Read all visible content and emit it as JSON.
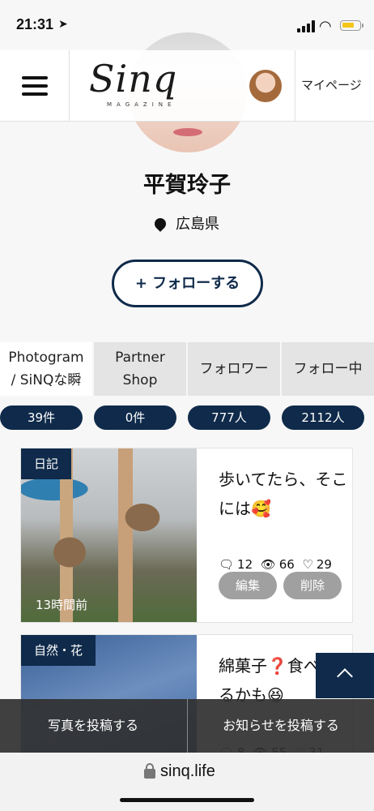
{
  "status_bar": {
    "time": "21:31",
    "location_arrow": "location-arrow-icon"
  },
  "header": {
    "menu_icon": "hamburger-icon",
    "logo_text": "Sinq",
    "logo_subtext": "MAGAZINE",
    "mypage_label": "マイページ"
  },
  "profile": {
    "name": "平賀玲子",
    "location": "広島県",
    "follow_label": "+ フォローする"
  },
  "stats": [
    {
      "label": "Photogram\n/ SiNQな瞬",
      "count": "39件"
    },
    {
      "label": "Partner\nShop",
      "count": "0件"
    },
    {
      "label": "フォロワー",
      "count": "777人"
    },
    {
      "label": "フォロー中",
      "count": "2112人"
    }
  ],
  "posts": [
    {
      "tag": "日記",
      "time_ago": "13時間前",
      "title": "歩いてたら、そこには🥰",
      "comments": "12",
      "views": "66",
      "likes": "29",
      "edit_label": "編集",
      "delete_label": "削除"
    },
    {
      "tag": "自然・花",
      "title": "綿菓子❓食べれるかも😆",
      "comments": "8",
      "views": "55",
      "likes": "31"
    }
  ],
  "bottom_bar": {
    "post_photo_label": "写真を投稿する",
    "post_news_label": "お知らせを投稿する"
  },
  "browser": {
    "url": "sinq.life"
  },
  "colors": {
    "navy": "#0f2a4a",
    "gray_button": "#a0a0a0",
    "tab_inactive": "#e4e4e4"
  }
}
